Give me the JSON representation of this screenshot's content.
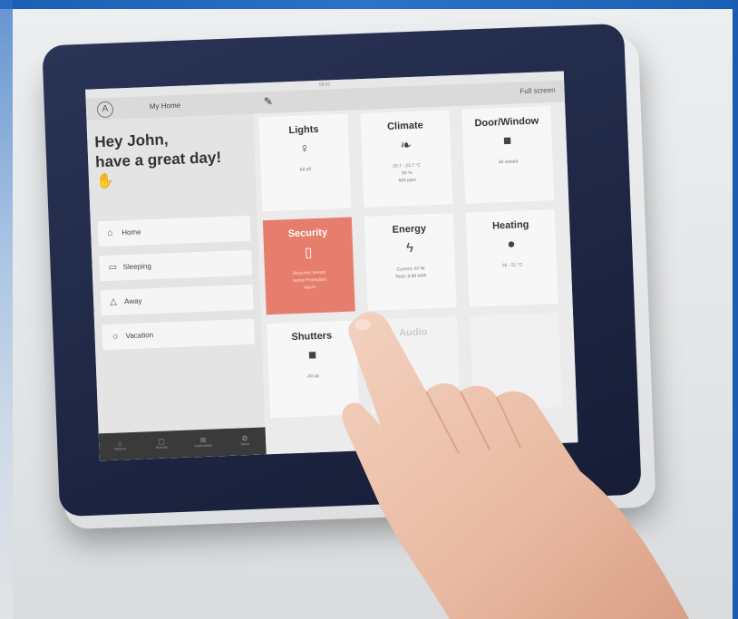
{
  "status_bar": {
    "time": "09:41"
  },
  "top_bar": {
    "avatar_letter": "A",
    "home_title": "My Home",
    "full_screen_label": "Full screen"
  },
  "greeting": {
    "line1": "Hey John,",
    "line2": "have a great day!"
  },
  "scenes": [
    {
      "label": "Home",
      "icon": "house-icon"
    },
    {
      "label": "Sleeping",
      "icon": "bed-icon"
    },
    {
      "label": "Away",
      "icon": "away-house-icon"
    },
    {
      "label": "Vacation",
      "icon": "sun-icon"
    }
  ],
  "bottom_nav": [
    {
      "label": "Rooms",
      "icon": "home-icon"
    },
    {
      "label": "Scenes",
      "icon": "scenes-icon"
    },
    {
      "label": "Automation",
      "icon": "automation-icon"
    },
    {
      "label": "More",
      "icon": "gear-icon"
    }
  ],
  "tiles": {
    "lights": {
      "title": "Lights",
      "status": "All off"
    },
    "climate": {
      "title": "Climate",
      "line1": "20.7 - 23.7 °C",
      "line2": "50 %",
      "line3": "684 ppm"
    },
    "door_window": {
      "title": "Door/Window",
      "status": "All closed"
    },
    "security": {
      "title": "Security",
      "line1": "Reached sensor",
      "line2": "Home Protection",
      "line3": "Alarm"
    },
    "energy": {
      "title": "Energy",
      "line1": "Current: 87 W",
      "line2": "Total: 8.98 kWh"
    },
    "heating": {
      "title": "Heating",
      "status": "16 - 21 °C"
    },
    "shutters": {
      "title": "Shutters",
      "status": "All up"
    },
    "audio": {
      "title": "Audio"
    }
  },
  "colors": {
    "security_tile": "#e77d6c",
    "bezel": "#1f2745",
    "accent_blue": "#1a5fb4"
  }
}
